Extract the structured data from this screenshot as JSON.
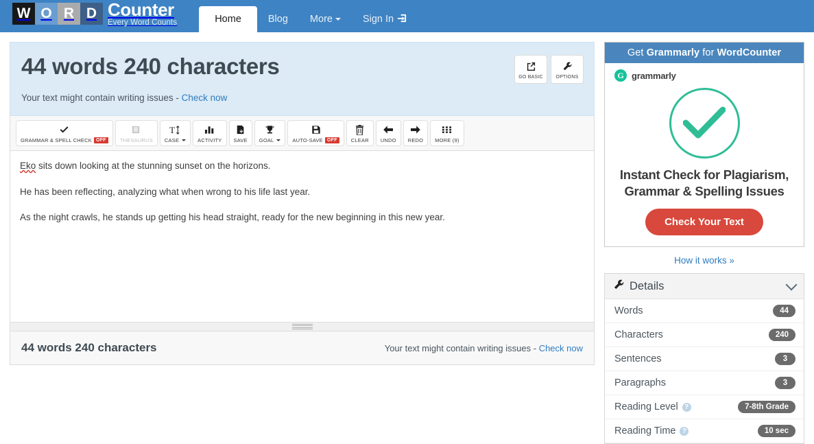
{
  "nav": {
    "logo": {
      "blocks": [
        "W",
        "O",
        "R",
        "D"
      ],
      "word_main": "Counter",
      "tagline": "Every Word Counts"
    },
    "links": [
      {
        "label": "Home",
        "active": true
      },
      {
        "label": "Blog",
        "active": false
      },
      {
        "label": "More",
        "active": false,
        "caret": true
      },
      {
        "label": "Sign In",
        "active": false,
        "icon": "sign-in-icon"
      }
    ]
  },
  "counter": {
    "title": "44 words 240 characters",
    "notice_text": "Your text might contain writing issues -",
    "notice_link": "Check now",
    "buttons": [
      {
        "label": "GO BASIC",
        "icon": "external-link-icon"
      },
      {
        "label": "OPTIONS",
        "icon": "wrench-icon"
      }
    ]
  },
  "toolbar": [
    {
      "label": "GRAMMAR & SPELL CHECK",
      "icon": "check-icon",
      "badge": "OFF",
      "disabled": false,
      "caret": false
    },
    {
      "label": "THESAURUS",
      "icon": "book-icon",
      "badge": null,
      "disabled": true,
      "caret": false
    },
    {
      "label": "CASE",
      "icon": "text-case-icon",
      "badge": null,
      "disabled": false,
      "caret": true
    },
    {
      "label": "ACTIVITY",
      "icon": "bar-chart-icon",
      "badge": null,
      "disabled": false,
      "caret": false
    },
    {
      "label": "SAVE",
      "icon": "save-download-icon",
      "badge": null,
      "disabled": false,
      "caret": false
    },
    {
      "label": "GOAL",
      "icon": "trophy-icon",
      "badge": null,
      "disabled": false,
      "caret": true
    },
    {
      "label": "AUTO-SAVE",
      "icon": "floppy-disk-icon",
      "badge": "OFF",
      "disabled": false,
      "caret": false
    },
    {
      "label": "CLEAR",
      "icon": "trash-icon",
      "badge": null,
      "disabled": false,
      "caret": false
    },
    {
      "label": "UNDO",
      "icon": "arrow-left-icon",
      "badge": null,
      "disabled": false,
      "caret": false
    },
    {
      "label": "REDO",
      "icon": "arrow-right-icon",
      "badge": null,
      "disabled": false,
      "caret": false
    },
    {
      "label": "MORE (9)",
      "icon": "grid-icon",
      "badge": null,
      "disabled": false,
      "caret": false
    }
  ],
  "editor": {
    "paragraphs": [
      {
        "misspelled": "Eko",
        "rest": " sits down looking at the stunning sunset on the horizons."
      },
      {
        "misspelled": "",
        "rest": "He has been reflecting, analyzing  what when wrong to his life last year."
      },
      {
        "misspelled": "",
        "rest": "As the night crawls, he stands up getting his head straight, ready for the new beginning in this new year."
      }
    ]
  },
  "footer": {
    "count": "44 words 240 characters",
    "notice_text": "Your text might contain writing issues -",
    "notice_link": "Check now"
  },
  "ad": {
    "head_pre": "Get ",
    "head_brand": "Grammarly",
    "head_mid": " for ",
    "head_site": "WordCounter",
    "logo_letter": "G",
    "logo_name": "grammarly",
    "tagline_line1": "Instant Check for Plagiarism,",
    "tagline_line2": "Grammar & Spelling Issues",
    "cta": "Check Your Text",
    "how_it_works": "How it works »"
  },
  "details": {
    "title": "Details",
    "rows": [
      {
        "label": "Words",
        "value": "44",
        "help": false
      },
      {
        "label": "Characters",
        "value": "240",
        "help": false
      },
      {
        "label": "Sentences",
        "value": "3",
        "help": false
      },
      {
        "label": "Paragraphs",
        "value": "3",
        "help": false
      },
      {
        "label": "Reading Level",
        "value": "7-8th Grade",
        "help": true
      },
      {
        "label": "Reading Time",
        "value": "10 sec",
        "help": true
      }
    ],
    "help_glyph": "?"
  },
  "colors": {
    "nav_blue": "#3E83C4",
    "band_blue": "#dcebf6",
    "link_blue": "#2e7bbf",
    "badge_red": "#d63a32",
    "cta_red": "#d8483c",
    "grammarly_green": "#15c39a",
    "pill_gray": "#6b6b6b"
  }
}
